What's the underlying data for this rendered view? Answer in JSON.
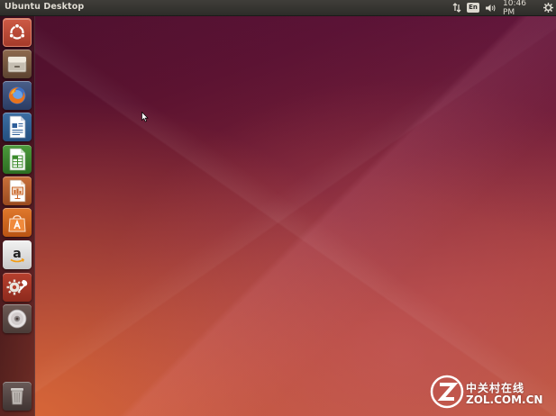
{
  "top_panel": {
    "window_title": "Ubuntu Desktop",
    "keyboard_layout": "En",
    "clock": "10:46 PM",
    "icons": {
      "network": "network-updown-icon",
      "sound": "volume-icon",
      "session": "gear-icon"
    }
  },
  "launcher": {
    "items": [
      {
        "name": "ubuntu-dash",
        "icon": "ubuntu-logo-icon"
      },
      {
        "name": "files",
        "icon": "file-cabinet-icon"
      },
      {
        "name": "firefox",
        "icon": "firefox-icon"
      },
      {
        "name": "libreoffice-writer",
        "icon": "writer-document-icon"
      },
      {
        "name": "libreoffice-calc",
        "icon": "calc-spreadsheet-icon"
      },
      {
        "name": "libreoffice-impress",
        "icon": "impress-presentation-icon"
      },
      {
        "name": "ubuntu-software-center",
        "icon": "shopping-bag-icon"
      },
      {
        "name": "amazon",
        "icon": "amazon-icon",
        "label": "a"
      },
      {
        "name": "system-settings",
        "icon": "settings-wrench-icon"
      },
      {
        "name": "dvd-drive",
        "icon": "disc-icon"
      },
      {
        "name": "trash",
        "icon": "trash-icon"
      }
    ]
  },
  "watermark": {
    "line1": "中关村在线",
    "line2": "ZOL.COM.CN"
  },
  "colors": {
    "panel": "#2d2c29",
    "dash_accent": "#cd5a45",
    "wallpaper_dark": "#4a0f2b",
    "wallpaper_warm": "#c05a3d"
  }
}
